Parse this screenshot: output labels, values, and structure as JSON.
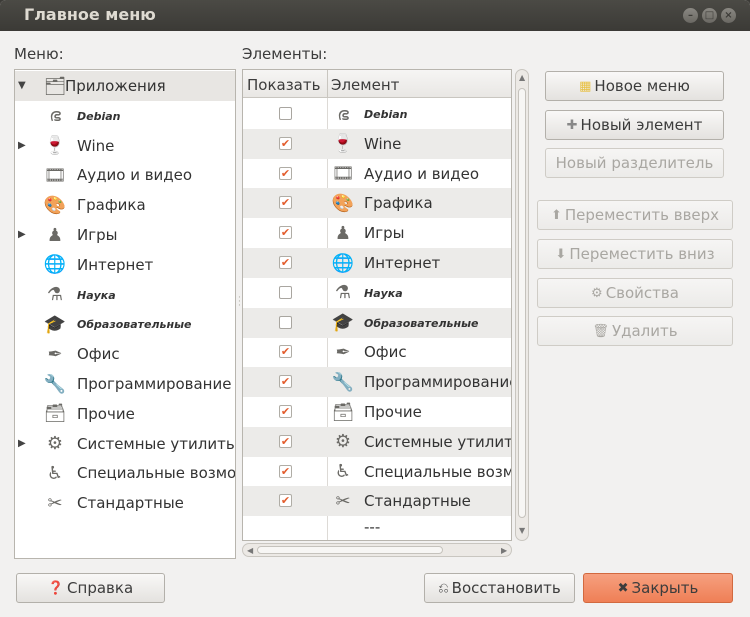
{
  "window": {
    "title": "Главное меню"
  },
  "labels": {
    "menus": "Меню:",
    "items": "Элементы:"
  },
  "tree": [
    {
      "label": "Приложения",
      "icon": "applications-icon",
      "glyph": "🗂",
      "expander": "▼",
      "small": false,
      "selected": true
    },
    {
      "label": "Debian",
      "icon": "debian-icon",
      "glyph": "ഭ",
      "expander": "",
      "small": true,
      "selected": false
    },
    {
      "label": "Wine",
      "icon": "wine-glass-icon",
      "glyph": "🍷",
      "expander": "▶",
      "small": false,
      "selected": false
    },
    {
      "label": "Аудио и видео",
      "icon": "multimedia-icon",
      "glyph": "🎞",
      "expander": "",
      "small": false,
      "selected": false
    },
    {
      "label": "Графика",
      "icon": "graphics-icon",
      "glyph": "🎨",
      "expander": "",
      "small": false,
      "selected": false
    },
    {
      "label": "Игры",
      "icon": "games-icon",
      "glyph": "♟",
      "expander": "▶",
      "small": false,
      "selected": false
    },
    {
      "label": "Интернет",
      "icon": "internet-icon",
      "glyph": "🌐",
      "expander": "",
      "small": false,
      "selected": false
    },
    {
      "label": "Наука",
      "icon": "science-icon",
      "glyph": "⚗",
      "expander": "",
      "small": true,
      "selected": false
    },
    {
      "label": "Образовательные",
      "icon": "education-icon",
      "glyph": "🎓",
      "expander": "",
      "small": true,
      "selected": false
    },
    {
      "label": "Офис",
      "icon": "office-icon",
      "glyph": "✒",
      "expander": "",
      "small": false,
      "selected": false
    },
    {
      "label": "Программирование",
      "icon": "programming-icon",
      "glyph": "🔧",
      "expander": "",
      "small": false,
      "selected": false
    },
    {
      "label": "Прочие",
      "icon": "other-icon",
      "glyph": "🗃",
      "expander": "",
      "small": false,
      "selected": false
    },
    {
      "label": "Системные утилиты",
      "icon": "system-tools-icon",
      "glyph": "⚙",
      "expander": "▶",
      "small": false,
      "selected": false
    },
    {
      "label": "Специальные возможности",
      "icon": "accessibility-icon",
      "glyph": "♿",
      "expander": "",
      "small": false,
      "selected": false
    },
    {
      "label": "Стандартные",
      "icon": "accessories-icon",
      "glyph": "✂",
      "expander": "",
      "small": false,
      "selected": false
    }
  ],
  "table": {
    "col_show": "Показать",
    "col_item": "Элемент",
    "rows": [
      {
        "label": "Debian",
        "icon": "debian-icon",
        "glyph": "ഭ",
        "checked": false,
        "small": true
      },
      {
        "label": "Wine",
        "icon": "wine-glass-icon",
        "glyph": "🍷",
        "checked": true,
        "small": false
      },
      {
        "label": "Аудио и видео",
        "icon": "multimedia-icon",
        "glyph": "🎞",
        "checked": true,
        "small": false
      },
      {
        "label": "Графика",
        "icon": "graphics-icon",
        "glyph": "🎨",
        "checked": true,
        "small": false
      },
      {
        "label": "Игры",
        "icon": "games-icon",
        "glyph": "♟",
        "checked": true,
        "small": false
      },
      {
        "label": "Интернет",
        "icon": "internet-icon",
        "glyph": "🌐",
        "checked": true,
        "small": false
      },
      {
        "label": "Наука",
        "icon": "science-icon",
        "glyph": "⚗",
        "checked": false,
        "small": true
      },
      {
        "label": "Образовательные",
        "icon": "education-icon",
        "glyph": "🎓",
        "checked": false,
        "small": true
      },
      {
        "label": "Офис",
        "icon": "office-icon",
        "glyph": "✒",
        "checked": true,
        "small": false
      },
      {
        "label": "Программирование",
        "icon": "programming-icon",
        "glyph": "🔧",
        "checked": true,
        "small": false
      },
      {
        "label": "Прочие",
        "icon": "other-icon",
        "glyph": "🗃",
        "checked": true,
        "small": false
      },
      {
        "label": "Системные утилиты",
        "icon": "system-tools-icon",
        "glyph": "⚙",
        "checked": true,
        "small": false
      },
      {
        "label": "Специальные возможности",
        "icon": "accessibility-icon",
        "glyph": "♿",
        "checked": true,
        "small": false
      },
      {
        "label": "Стандартные",
        "icon": "accessories-icon",
        "glyph": "✂",
        "checked": true,
        "small": false
      },
      {
        "label": "---",
        "icon": "",
        "glyph": "",
        "checked": null,
        "small": false
      }
    ]
  },
  "buttons": {
    "new_menu": "Новое меню",
    "new_item": "Новый элемент",
    "new_separator": "Новый разделитель",
    "move_up": "Переместить вверх",
    "move_down": "Переместить вниз",
    "properties": "Свойства",
    "delete": "Удалить",
    "help": "Справка",
    "revert": "Восстановить",
    "close": "Закрыть"
  },
  "colors": {
    "accent": "#ef7f56",
    "check": "#e35c2c"
  }
}
